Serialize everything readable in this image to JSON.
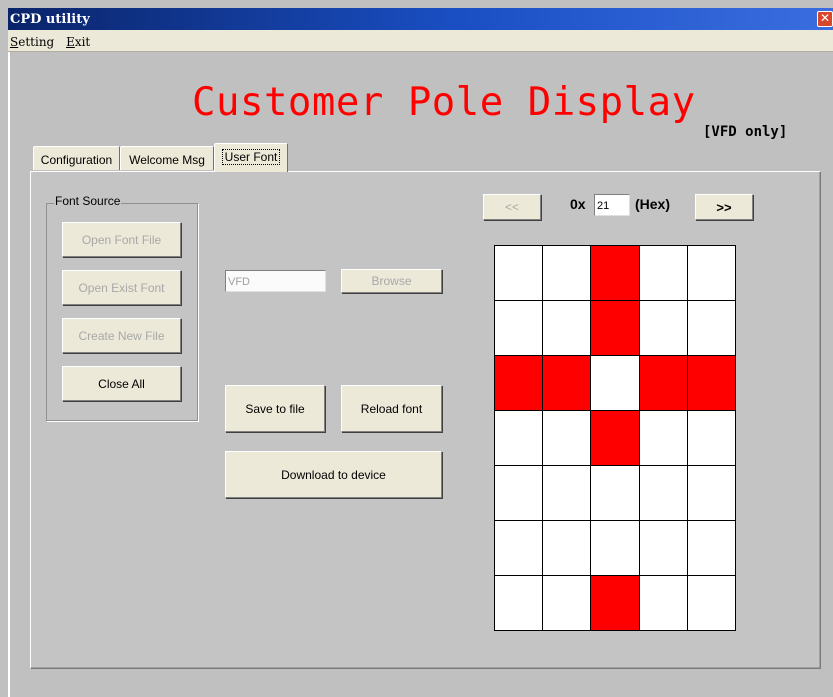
{
  "window": {
    "title": "CPD utility",
    "close_glyph": "✕"
  },
  "menu": {
    "items": [
      {
        "accel": "S",
        "rest": "etting"
      },
      {
        "accel": "E",
        "rest": "xit"
      }
    ]
  },
  "header": {
    "title": "Customer Pole Display",
    "note": "[VFD only]"
  },
  "tabs": [
    {
      "label": "Configuration",
      "active": false
    },
    {
      "label": "Welcome Msg",
      "active": false
    },
    {
      "label": "User Font",
      "active": true
    }
  ],
  "font_source": {
    "label": "Font Source",
    "buttons": [
      {
        "label": "Open Font File",
        "enabled": false
      },
      {
        "label": "Open Exist Font",
        "enabled": false
      },
      {
        "label": "Create New File",
        "enabled": false
      },
      {
        "label": "Close All",
        "enabled": true
      }
    ]
  },
  "file": {
    "path_value": "VFD",
    "browse_label": "Browse",
    "save_label": "Save to file",
    "reload_label": "Reload font",
    "download_label": "Download to device"
  },
  "char_nav": {
    "prev_label": "<<",
    "next_label": ">>",
    "prefix": "0x",
    "code_value": "21",
    "suffix": "(Hex)"
  },
  "font_grid": {
    "cols": 5,
    "rows": 7,
    "pixels": [
      [
        0,
        0,
        1,
        0,
        0
      ],
      [
        0,
        0,
        1,
        0,
        0
      ],
      [
        1,
        1,
        0,
        1,
        1
      ],
      [
        0,
        0,
        1,
        0,
        0
      ],
      [
        0,
        0,
        0,
        0,
        0
      ],
      [
        0,
        0,
        0,
        0,
        0
      ],
      [
        0,
        0,
        1,
        0,
        0
      ]
    ],
    "on_color": "#ff0000",
    "off_color": "#ffffff"
  }
}
